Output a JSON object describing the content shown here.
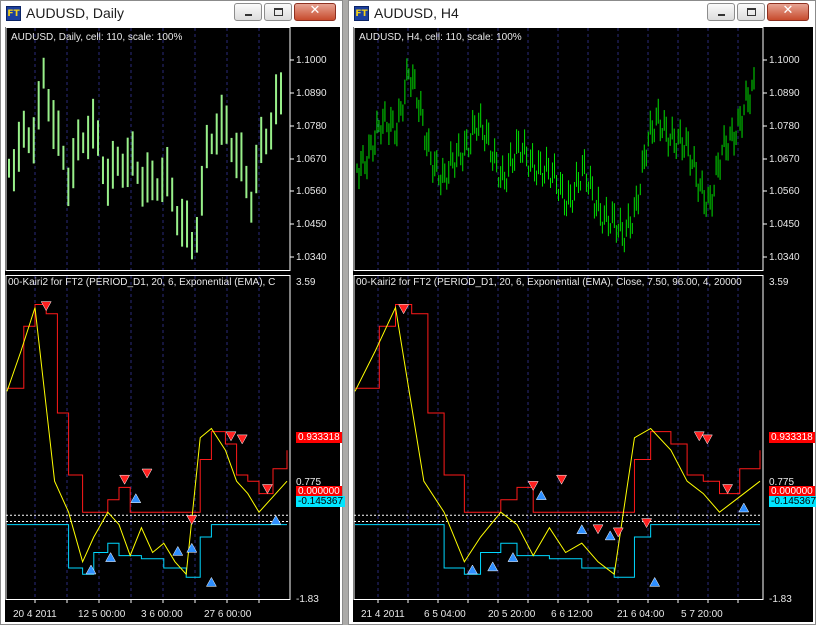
{
  "windows": [
    {
      "title": "AUDUSD, Daily",
      "main_info": "AUDUSD, Daily, cell: 110, scale: 100%",
      "price_ticks": [
        "1.1000",
        "1.0890",
        "1.0780",
        "1.0670",
        "1.0560",
        "1.0450",
        "1.0340"
      ],
      "indicator_info": "00-Kairi2 for FT2 (PERIOD_D1, 20, 6, Exponential (EMA), C",
      "indicator_top": "3.59",
      "indicator_bottom": "-1.83",
      "tag_red": "0.933318",
      "tag_red_partial": "0.000000",
      "tag_mid": "0.775",
      "tag_cyan": "-0.145367",
      "time_labels": [
        "20 4 2011",
        "12 5 00:00",
        "3 6 00:00",
        "27 6 00:00"
      ]
    },
    {
      "title": "AUDUSD, H4",
      "main_info": "AUDUSD, H4, cell: 110, scale: 100%",
      "price_ticks": [
        "1.1000",
        "1.0890",
        "1.0780",
        "1.0670",
        "1.0560",
        "1.0450",
        "1.0340"
      ],
      "indicator_info": "00-Kairi2 for FT2 (PERIOD_D1, 20, 6, Exponential (EMA), Close, 7.50, 96.00, 4, 20000",
      "indicator_top": "3.59",
      "indicator_bottom": "-1.83",
      "tag_red": "0.933318",
      "tag_red_partial": "0.000000",
      "tag_mid": "0.775",
      "tag_cyan": "-0.145367",
      "time_labels": [
        "21 4 2011",
        "6 5 04:00",
        "20 5 20:00",
        "6 6 12:00",
        "21 6 04:00",
        "5 7 20:00"
      ]
    }
  ],
  "colors": {
    "background": "#000000",
    "price_daily": "#98f08a",
    "price_h4": "#00e000",
    "kairi_yellow": "#ffff00",
    "kairi_cyan": "#00d8ff",
    "kairi_red": "#ff1a1a",
    "arrow_blue": "#2e8fff",
    "arrow_red": "#ff2020",
    "grid": "#2a2a7a"
  }
}
